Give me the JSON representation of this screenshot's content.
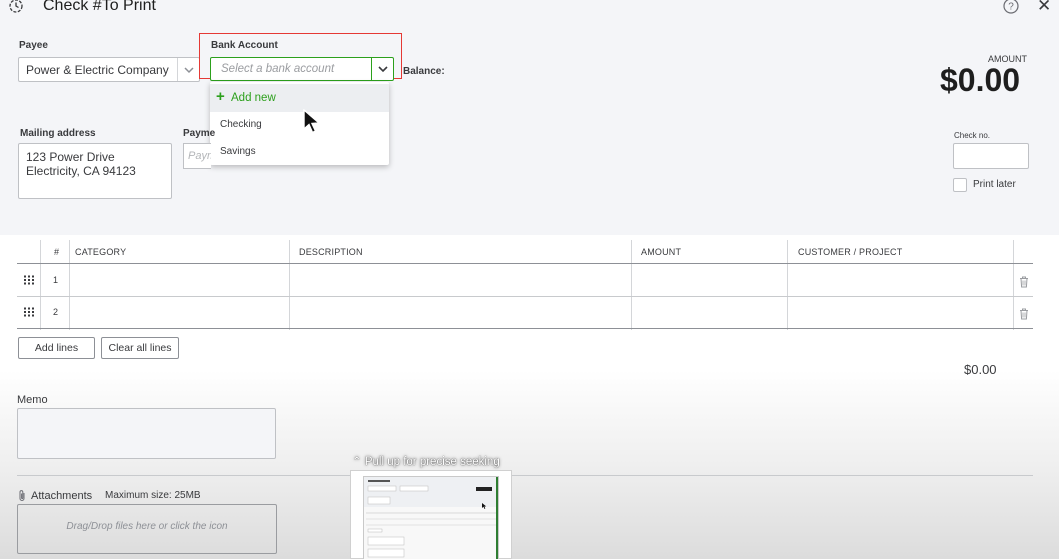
{
  "header": {
    "title": "Check #To Print"
  },
  "payee": {
    "label": "Payee",
    "value": "Power & Electric Company"
  },
  "bank_account": {
    "label": "Bank Account",
    "placeholder": "Select a bank account",
    "balance_label": "Balance:",
    "dropdown": {
      "add_new": "Add new",
      "options": [
        "Checking",
        "Savings"
      ]
    }
  },
  "amount": {
    "label": "AMOUNT",
    "value": "$0.00"
  },
  "mailing": {
    "label": "Mailing address",
    "lines": [
      "123 Power Drive",
      "Electricity, CA 94123"
    ]
  },
  "payment": {
    "label": "Payme",
    "placeholder": "Paym"
  },
  "check": {
    "no_label": "Check no.",
    "print_later": "Print later"
  },
  "table": {
    "headers": [
      "#",
      "CATEGORY",
      "DESCRIPTION",
      "AMOUNT",
      "CUSTOMER / PROJECT"
    ],
    "rows": [
      {
        "num": "1"
      },
      {
        "num": "2"
      }
    ]
  },
  "buttons": {
    "add_lines": "Add lines",
    "clear_all_lines": "Clear all lines"
  },
  "total": "$0.00",
  "memo": {
    "label": "Memo"
  },
  "attachments": {
    "label": "Attachments",
    "max_size": "Maximum size: 25MB",
    "drop_text": "Drag/Drop files here or click the icon"
  },
  "overlay": {
    "seek_text": "Pull up for precise seeking"
  },
  "colors": {
    "accent_green": "#2ca01c",
    "highlight_red": "#e53935",
    "text": "#393a3d"
  }
}
